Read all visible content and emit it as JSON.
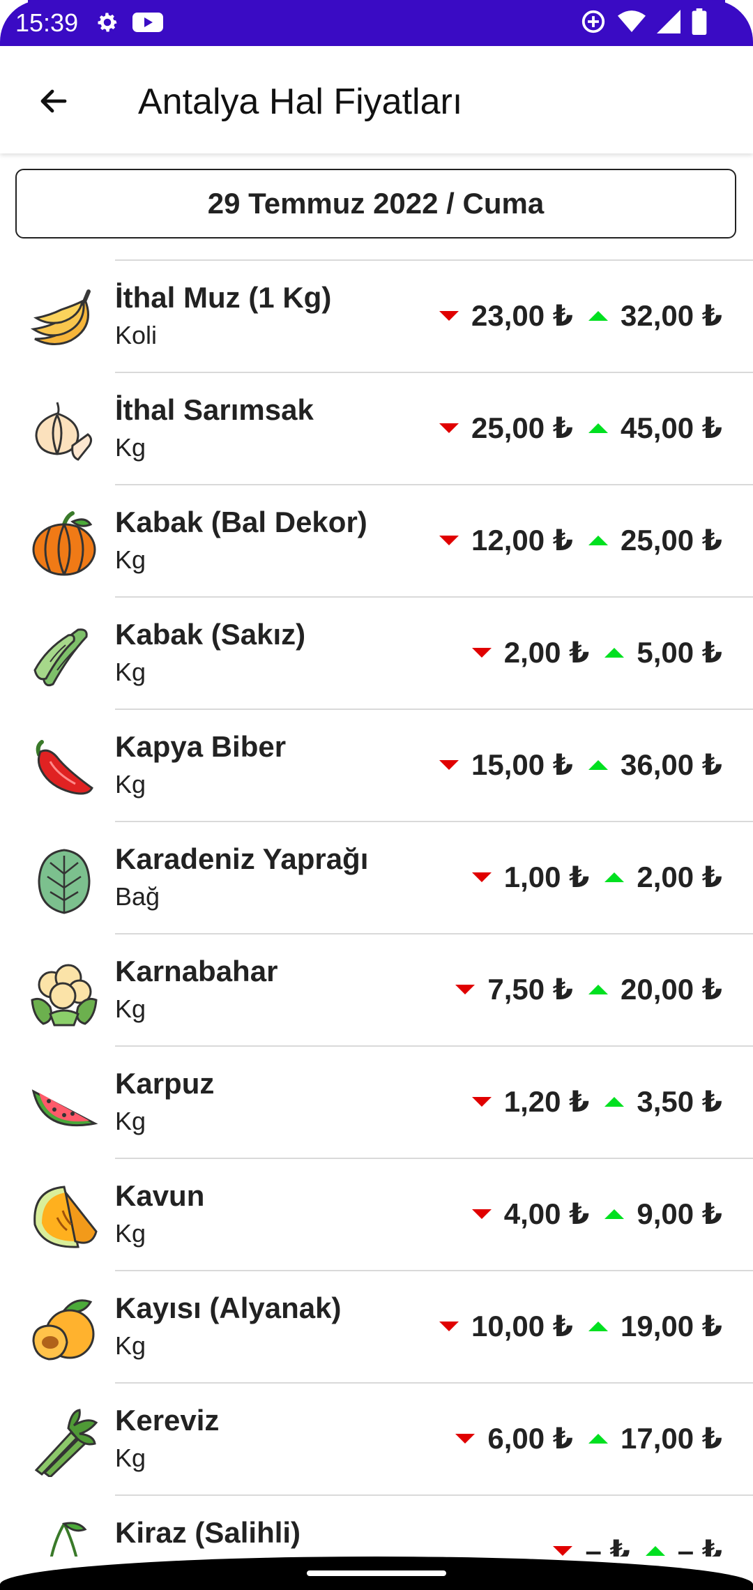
{
  "status_bar": {
    "time": "15:39",
    "left_icons": [
      "gear-icon",
      "youtube-icon"
    ],
    "right_icons": [
      "data-saver-icon",
      "wifi-icon",
      "signal-icon",
      "battery-icon"
    ]
  },
  "app_bar": {
    "title": "Antalya Hal Fiyatları",
    "back_icon": "arrow-left-icon"
  },
  "date_label": "29 Temmuz 2022 / Cuma",
  "colors": {
    "status_bar": "#3a0bc4",
    "price_down": "#e00000",
    "price_up": "#00e020"
  },
  "items": [
    {
      "name": "İthal Muz (1 Kg)",
      "unit": "Koli",
      "min": "23,00 ₺",
      "max": "32,00 ₺",
      "icon": "banana-icon"
    },
    {
      "name": "İthal Sarımsak",
      "unit": "Kg",
      "min": "25,00 ₺",
      "max": "45,00 ₺",
      "icon": "garlic-icon"
    },
    {
      "name": "Kabak (Bal Dekor)",
      "unit": "Kg",
      "min": "12,00 ₺",
      "max": "25,00 ₺",
      "icon": "pumpkin-icon"
    },
    {
      "name": "Kabak (Sakız)",
      "unit": "Kg",
      "min": "2,00 ₺",
      "max": "5,00 ₺",
      "icon": "zucchini-icon"
    },
    {
      "name": "Kapya Biber",
      "unit": "Kg",
      "min": "15,00 ₺",
      "max": "36,00 ₺",
      "icon": "pepper-icon"
    },
    {
      "name": "Karadeniz Yaprağı",
      "unit": "Bağ",
      "min": "1,00 ₺",
      "max": "2,00 ₺",
      "icon": "leaf-icon"
    },
    {
      "name": "Karnabahar",
      "unit": "Kg",
      "min": "7,50 ₺",
      "max": "20,00 ₺",
      "icon": "cauliflower-icon"
    },
    {
      "name": "Karpuz",
      "unit": "Kg",
      "min": "1,20 ₺",
      "max": "3,50 ₺",
      "icon": "watermelon-icon"
    },
    {
      "name": "Kavun",
      "unit": "Kg",
      "min": "4,00 ₺",
      "max": "9,00 ₺",
      "icon": "melon-icon"
    },
    {
      "name": "Kayısı (Alyanak)",
      "unit": "Kg",
      "min": "10,00 ₺",
      "max": "19,00 ₺",
      "icon": "apricot-icon"
    },
    {
      "name": "Kereviz",
      "unit": "Kg",
      "min": "6,00 ₺",
      "max": "17,00 ₺",
      "icon": "celery-icon"
    },
    {
      "name": "Kiraz (Salihli)",
      "unit": "",
      "min": "– ₺",
      "max": "– ₺",
      "icon": "cherry-icon"
    }
  ]
}
